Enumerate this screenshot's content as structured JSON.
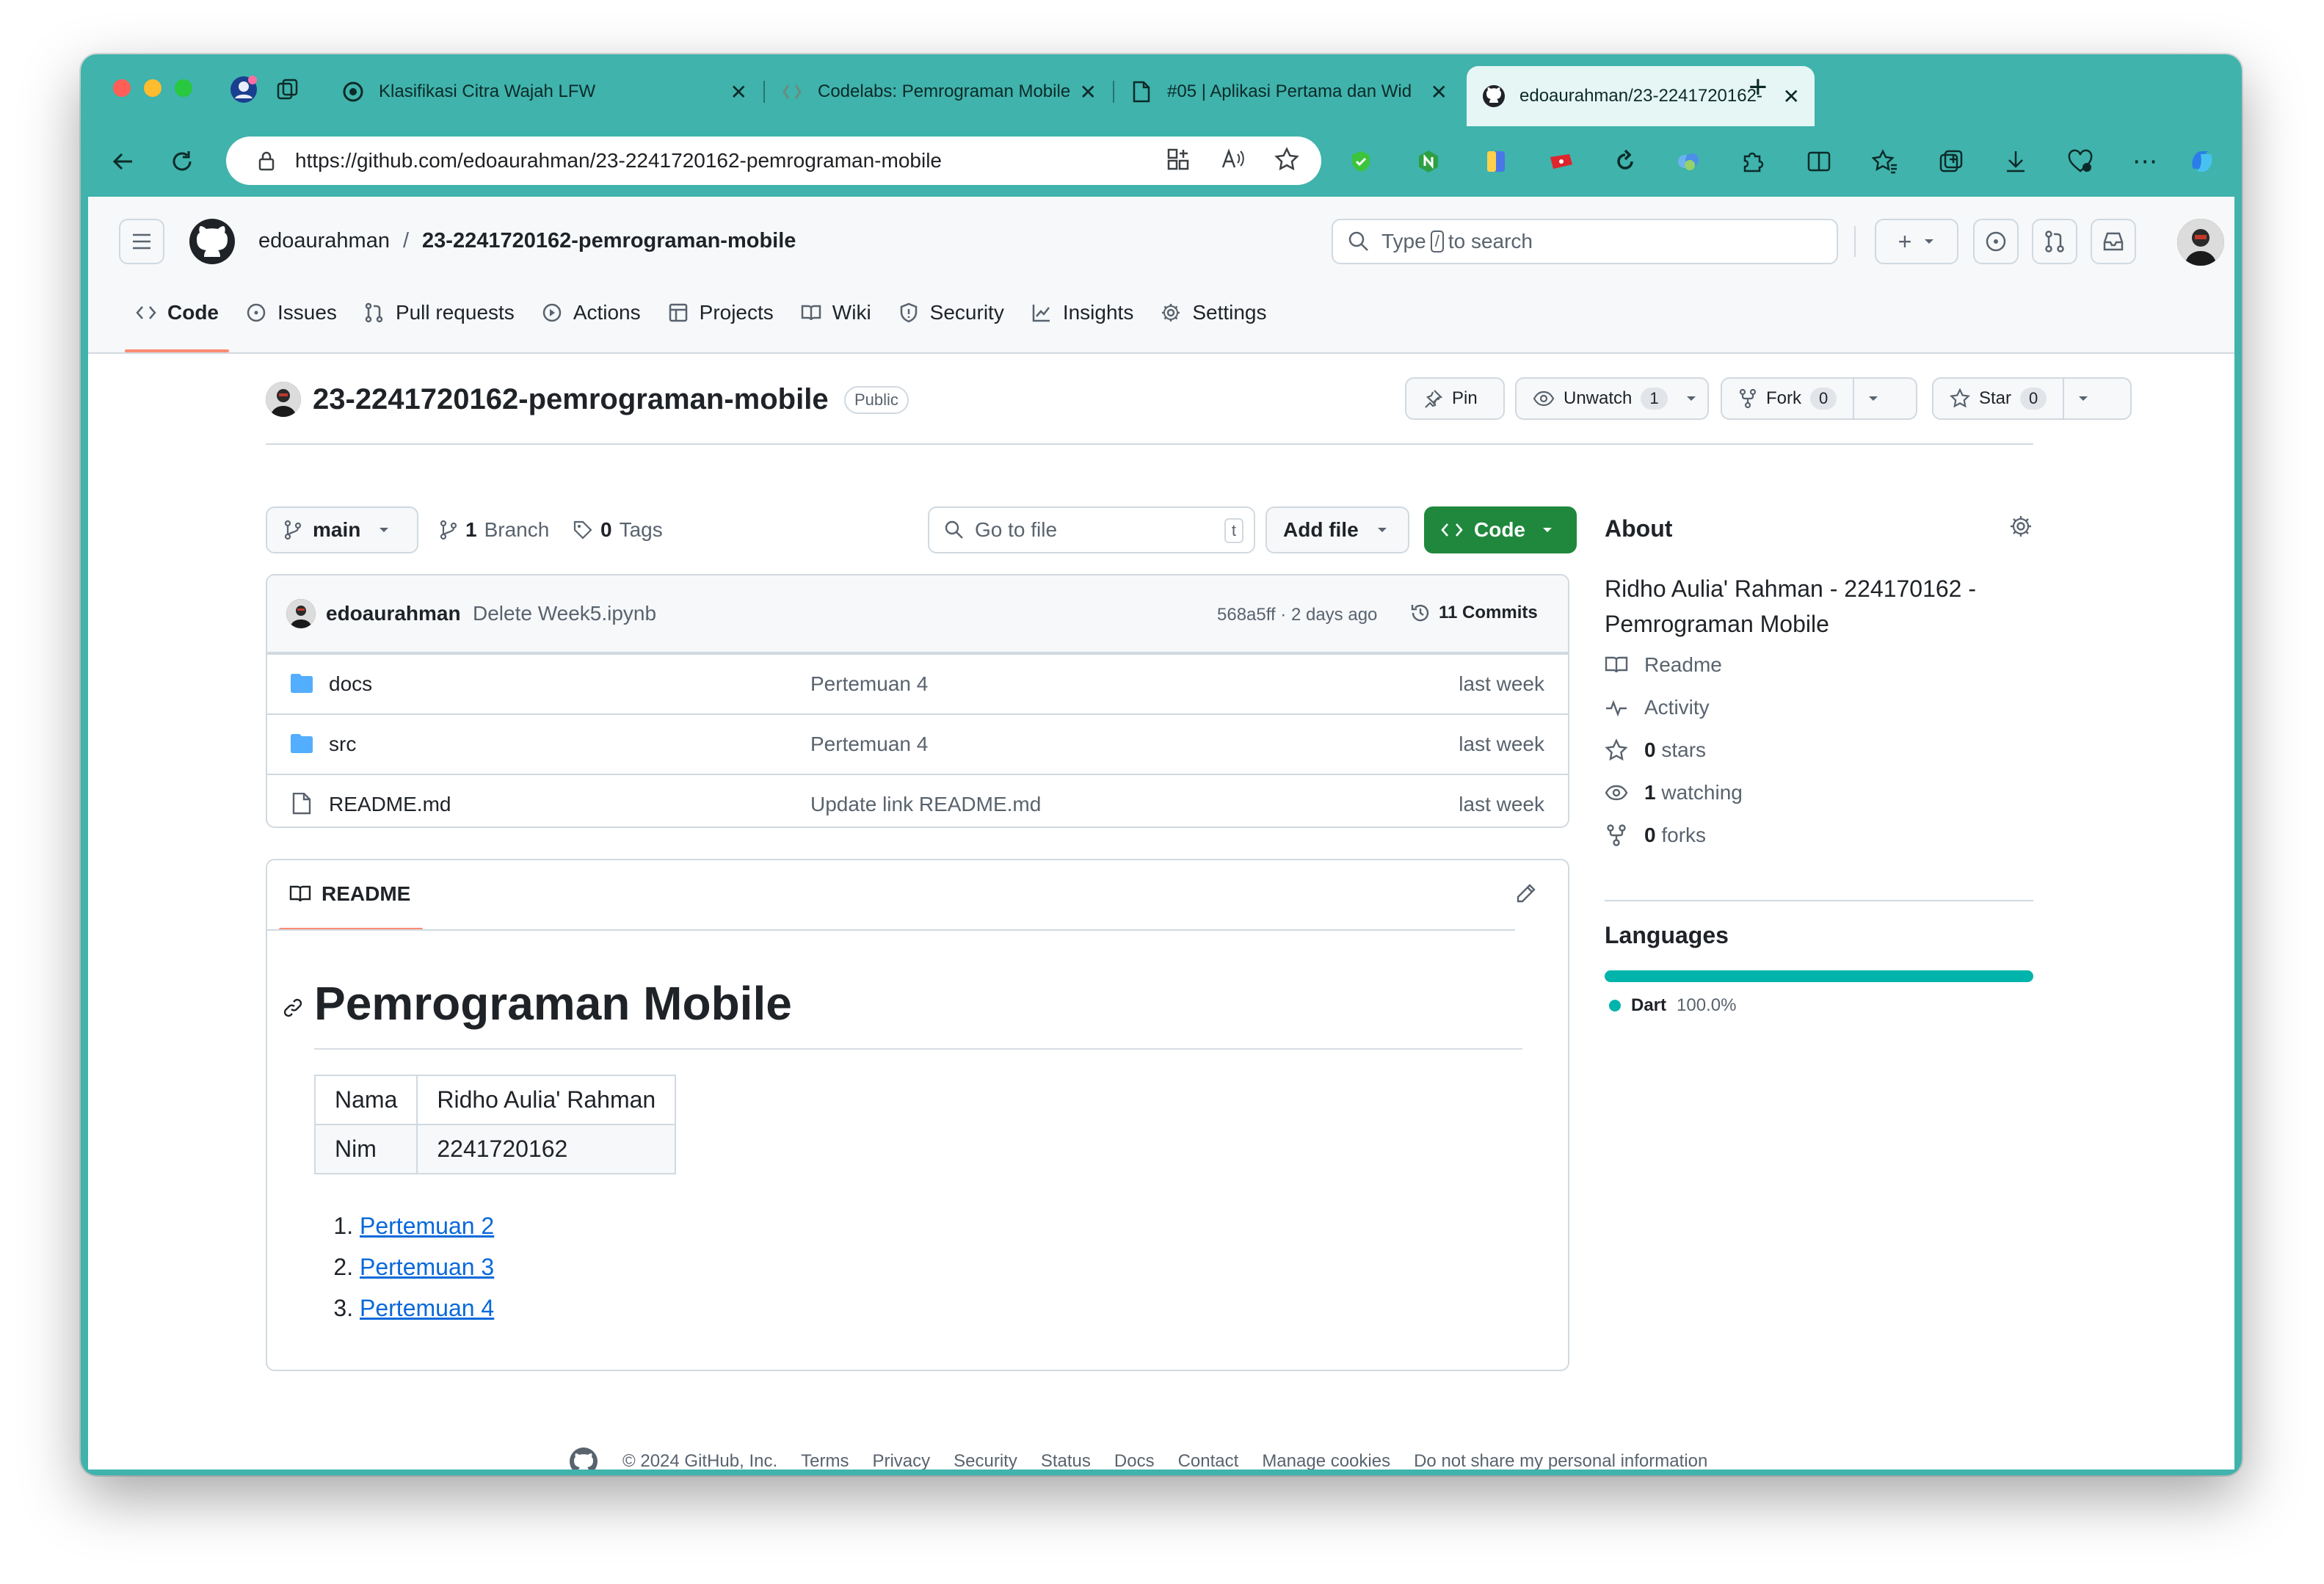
{
  "browser": {
    "tabs": [
      {
        "title": "Klasifikasi Citra Wajah LFW",
        "active": false
      },
      {
        "title": "Codelabs: Pemrograman Mobile",
        "active": false
      },
      {
        "title": "#05 | Aplikasi Pertama dan Wid",
        "active": false
      },
      {
        "title": "edoaurahman/23-2241720162-",
        "active": true
      }
    ],
    "new_tab": "+",
    "url": "https://github.com/edoaurahman/23-2241720162-pemrograman-mobile"
  },
  "header": {
    "owner": "edoaurahman",
    "separator": "/",
    "repo": "23-2241720162-pemrograman-mobile",
    "search_prefix": "Type",
    "search_key": "/",
    "search_suffix": "to search"
  },
  "repo_nav": [
    {
      "label": "Code",
      "icon": "code-icon",
      "active": true
    },
    {
      "label": "Issues",
      "icon": "issue-icon"
    },
    {
      "label": "Pull requests",
      "icon": "pull-request-icon"
    },
    {
      "label": "Actions",
      "icon": "play-icon"
    },
    {
      "label": "Projects",
      "icon": "table-icon"
    },
    {
      "label": "Wiki",
      "icon": "book-icon"
    },
    {
      "label": "Security",
      "icon": "shield-icon"
    },
    {
      "label": "Insights",
      "icon": "graph-icon"
    },
    {
      "label": "Settings",
      "icon": "gear-icon"
    }
  ],
  "repo": {
    "name": "23-2241720162-pemrograman-mobile",
    "visibility": "Public",
    "pin": "Pin",
    "unwatch": "Unwatch",
    "watch_count": "1",
    "fork": "Fork",
    "fork_count": "0",
    "star": "Star",
    "star_count": "0"
  },
  "branch_bar": {
    "branch": "main",
    "branch_count": "1",
    "branch_label": "Branch",
    "tag_count": "0",
    "tag_label": "Tags",
    "goto_placeholder": "Go to file",
    "goto_key": "t",
    "add_file": "Add file",
    "code": "Code"
  },
  "commit": {
    "author": "edoaurahman",
    "message": "Delete Week5.ipynb",
    "meta": "568a5ff · 2 days ago",
    "commits": "11 Commits"
  },
  "files": [
    {
      "name": "docs",
      "type": "folder",
      "message": "Pertemuan 4",
      "time": "last week"
    },
    {
      "name": "src",
      "type": "folder",
      "message": "Pertemuan 4",
      "time": "last week"
    },
    {
      "name": "README.md",
      "type": "file",
      "message": "Update link README.md",
      "time": "last week"
    }
  ],
  "readme": {
    "tab": "README",
    "heading": "Pemrograman Mobile",
    "table": [
      [
        "Nama",
        "Ridho Aulia' Rahman"
      ],
      [
        "Nim",
        "2241720162"
      ]
    ],
    "links": [
      "Pertemuan 2",
      "Pertemuan 3",
      "Pertemuan 4"
    ]
  },
  "about": {
    "title": "About",
    "description": "Ridho Aulia' Rahman - 224170162 - Pemrograman Mobile",
    "readme": "Readme",
    "activity": "Activity",
    "stars_count": "0",
    "stars_label": "stars",
    "watching_count": "1",
    "watching_label": "watching",
    "forks_count": "0",
    "forks_label": "forks",
    "languages_title": "Languages",
    "language": "Dart",
    "language_pct": "100.0%",
    "language_share": 1.0,
    "language_color": "#00b4ab"
  },
  "footer": {
    "copyright": "© 2024 GitHub, Inc.",
    "links": [
      "Terms",
      "Privacy",
      "Security",
      "Status",
      "Docs",
      "Contact",
      "Manage cookies",
      "Do not share my personal information"
    ]
  },
  "colors": {
    "chrome": "#3fb3ac",
    "code_button": "#1f883d",
    "active_tab_underline": "#fd8c73",
    "link": "#0969da"
  }
}
